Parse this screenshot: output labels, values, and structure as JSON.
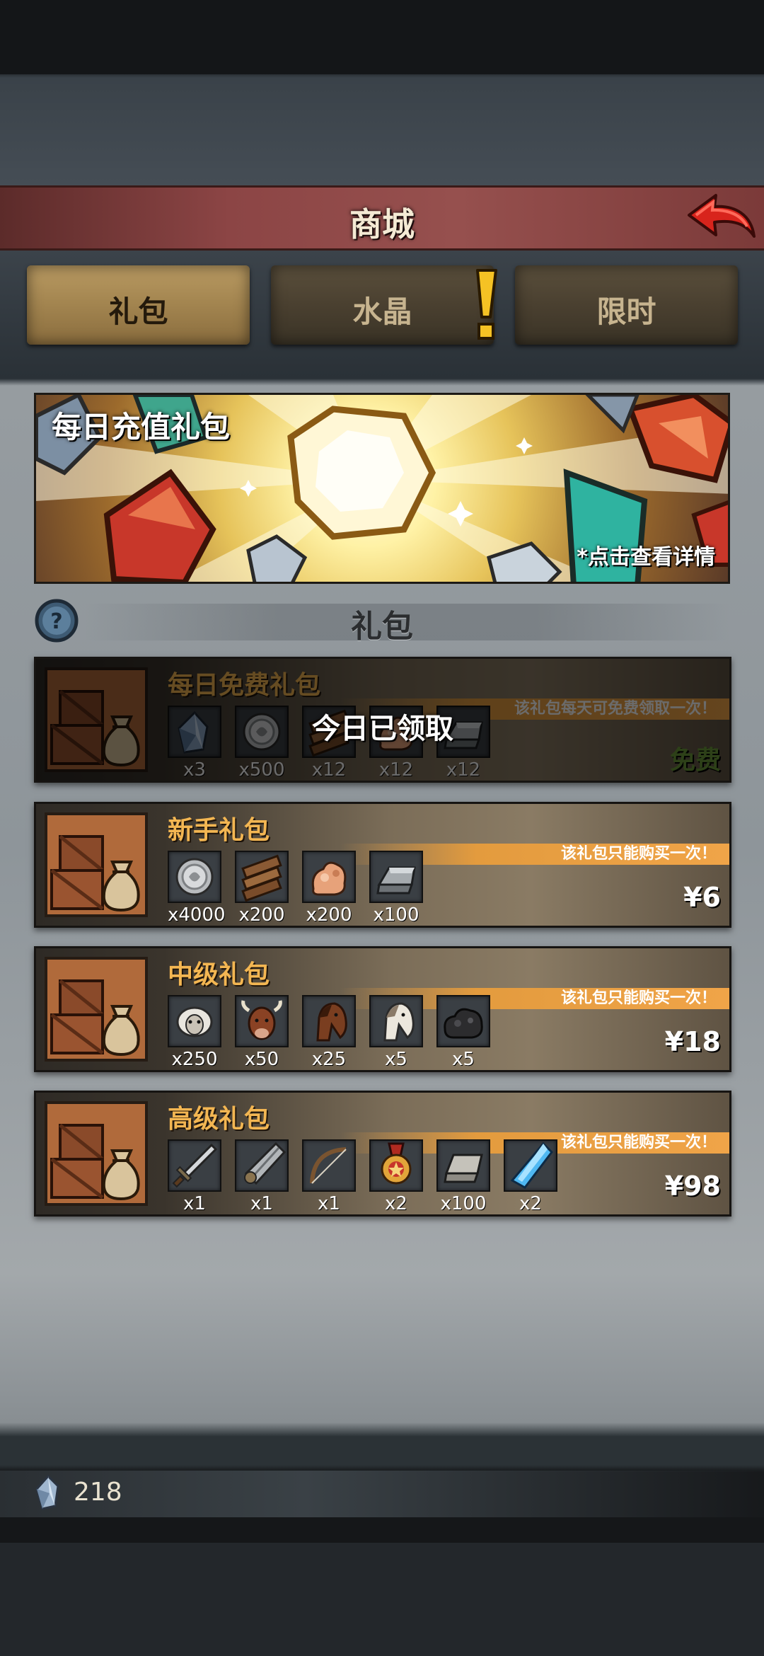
{
  "header": {
    "title": "商城"
  },
  "tabs": [
    {
      "label": "礼包",
      "active": true
    },
    {
      "label": "水晶",
      "active": false,
      "alert": true
    },
    {
      "label": "限时",
      "active": false
    }
  ],
  "banner": {
    "title": "每日充值礼包",
    "hint": "*点击查看详情"
  },
  "section": {
    "title": "礼包"
  },
  "packs": [
    {
      "name": "每日免费礼包",
      "note": "该礼包每天可免费领取一次！",
      "price": "免费",
      "claimed": true,
      "claimed_label": "今日已领取",
      "items": [
        {
          "icon": "crystal-icon",
          "qty": "x3"
        },
        {
          "icon": "silver-coin-icon",
          "qty": "x500"
        },
        {
          "icon": "wood-planks-icon",
          "qty": "x12"
        },
        {
          "icon": "ore-icon",
          "qty": "x12"
        },
        {
          "icon": "iron-ingot-icon",
          "qty": "x12"
        }
      ]
    },
    {
      "name": "新手礼包",
      "note": "该礼包只能购买一次！",
      "price": "¥6",
      "items": [
        {
          "icon": "silver-coin-icon",
          "qty": "x4000"
        },
        {
          "icon": "wood-planks-icon",
          "qty": "x200"
        },
        {
          "icon": "ore-icon",
          "qty": "x200"
        },
        {
          "icon": "iron-ingot-icon",
          "qty": "x100"
        }
      ]
    },
    {
      "name": "中级礼包",
      "note": "该礼包只能购买一次！",
      "price": "¥18",
      "items": [
        {
          "icon": "sheep-icon",
          "qty": "x250"
        },
        {
          "icon": "cow-icon",
          "qty": "x50"
        },
        {
          "icon": "brown-horse-icon",
          "qty": "x25"
        },
        {
          "icon": "white-horse-icon",
          "qty": "x5"
        },
        {
          "icon": "coal-icon",
          "qty": "x5"
        }
      ]
    },
    {
      "name": "高级礼包",
      "note": "该礼包只能购买一次！",
      "price": "¥98",
      "items": [
        {
          "icon": "sword-icon",
          "qty": "x1"
        },
        {
          "icon": "greatsword-icon",
          "qty": "x1"
        },
        {
          "icon": "bow-icon",
          "qty": "x1"
        },
        {
          "icon": "medal-icon",
          "qty": "x2"
        },
        {
          "icon": "stone-brick-icon",
          "qty": "x100"
        },
        {
          "icon": "blue-crystal-icon",
          "qty": "x2"
        }
      ]
    }
  ],
  "footer": {
    "crystal_count": "218"
  },
  "colors": {
    "accent_gold": "#f3b652",
    "note_orange": "#e39b3e",
    "free_green": "#6d9a3a",
    "title_red": "#8c4545"
  }
}
